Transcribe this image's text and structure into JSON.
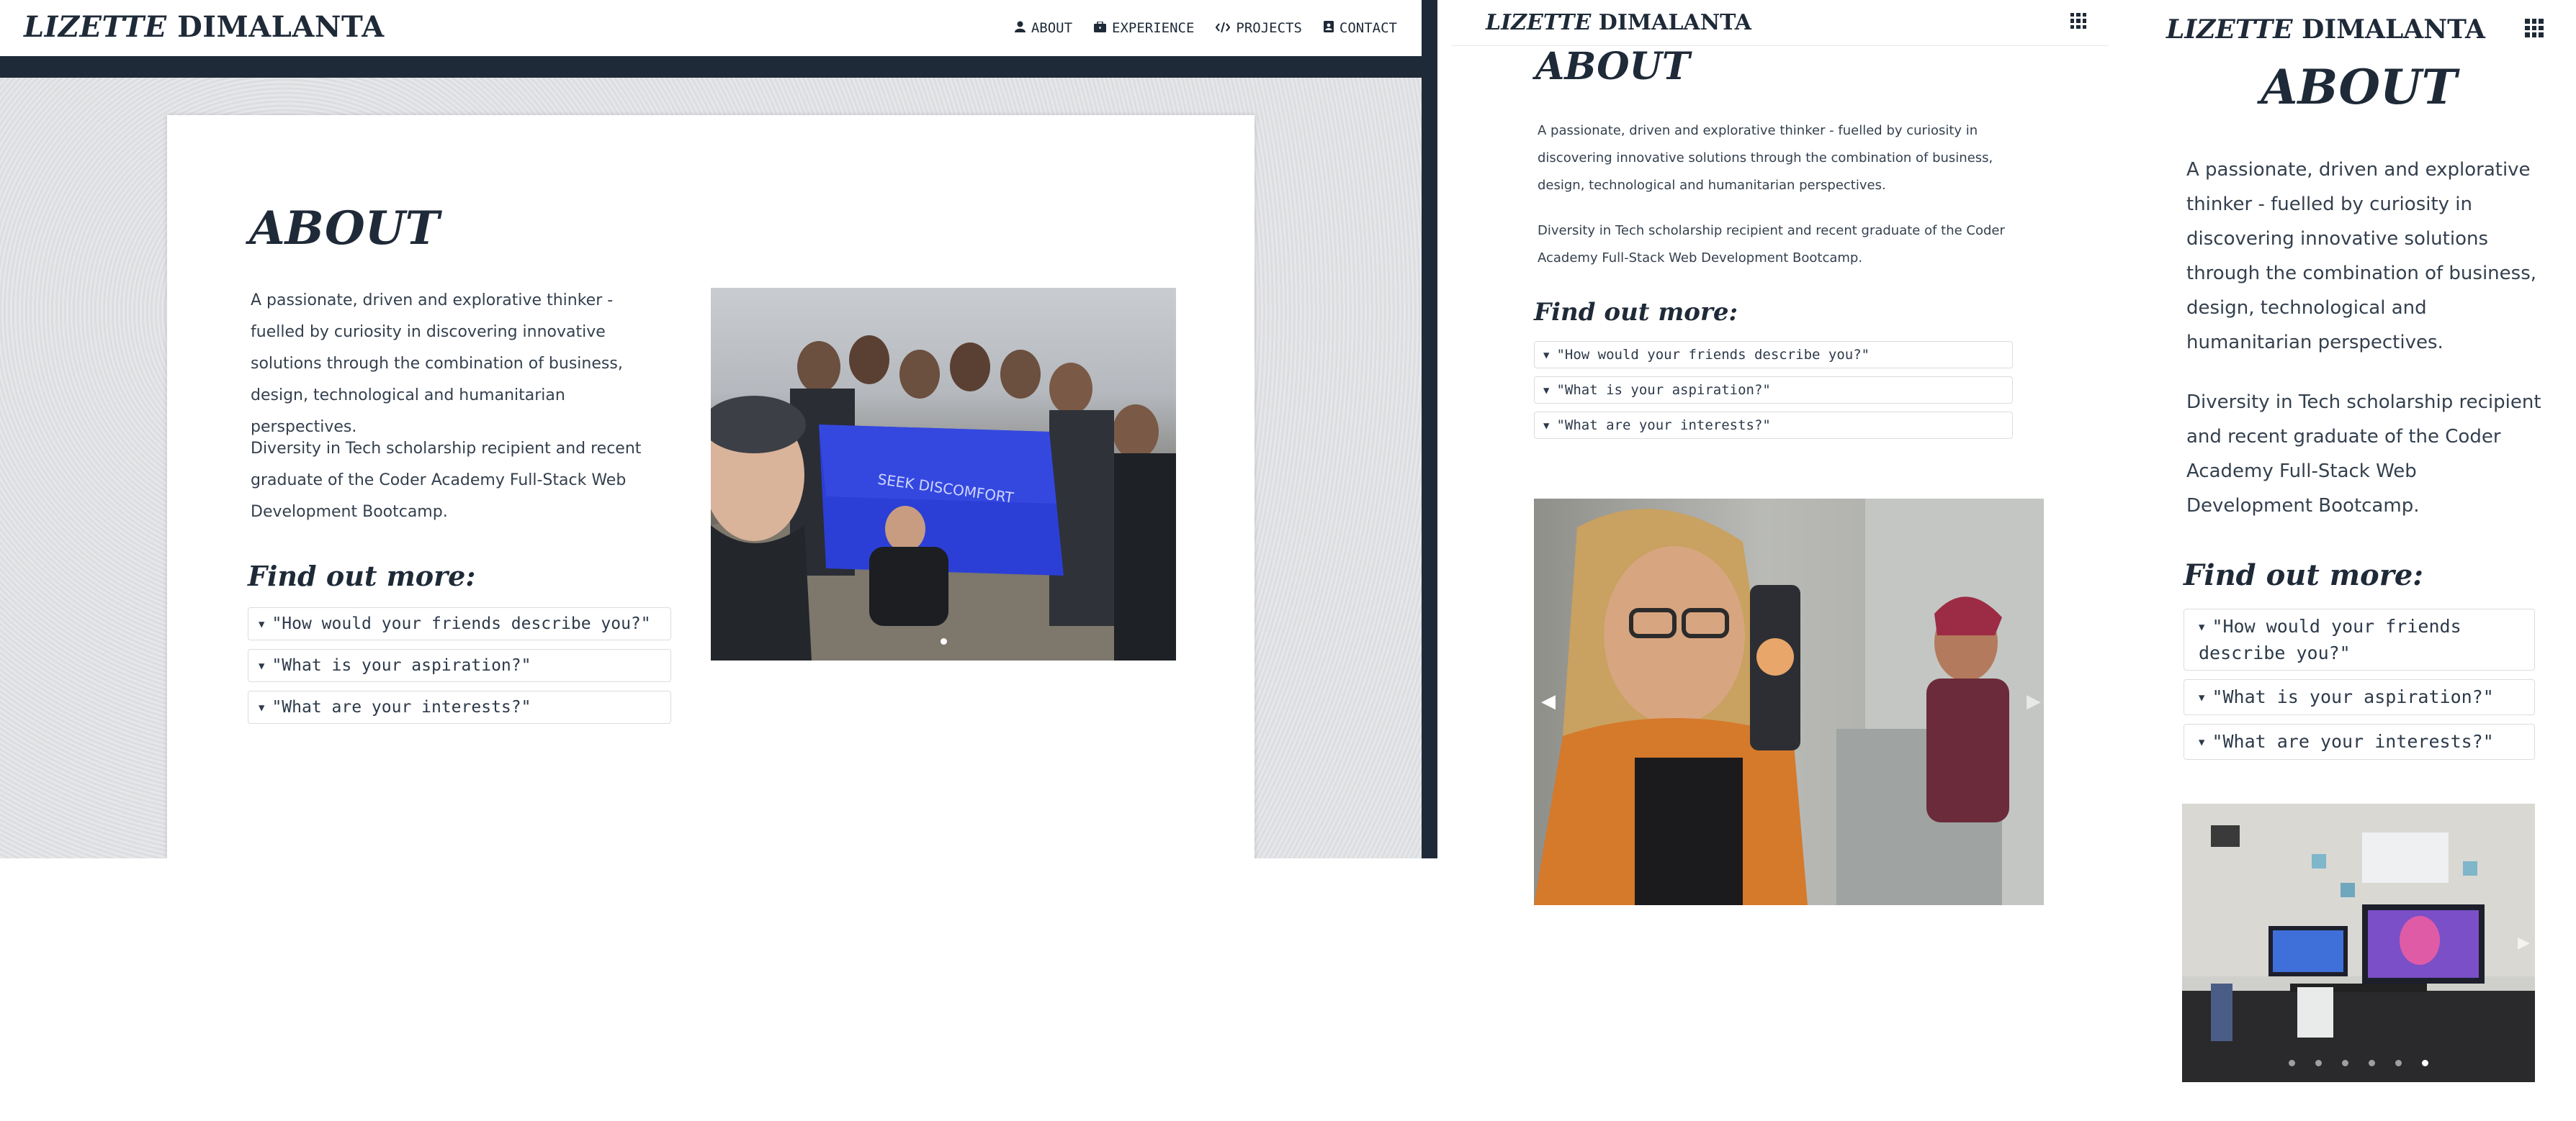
{
  "brand": {
    "first": "LIZETTE",
    "last": "DIMALANTA"
  },
  "nav": [
    {
      "label": "ABOUT",
      "icon": "user-icon"
    },
    {
      "label": "EXPERIENCE",
      "icon": "briefcase-icon"
    },
    {
      "label": "PROJECTS",
      "icon": "code-icon"
    },
    {
      "label": "CONTACT",
      "icon": "contact-card-icon"
    }
  ],
  "about": {
    "title": "ABOUT",
    "para1": "A passionate, driven and explorative thinker - fuelled by curiosity in discovering innovative solutions through the combination of business, design, technological and humanitarian perspectives.",
    "para2": "Diversity in Tech scholarship recipient and recent graduate of the Coder Academy Full-Stack Web Development Bootcamp.",
    "find_more": "Find out more:",
    "questions": [
      "\"How would your friends describe you?\"",
      "\"What is your aspiration?\"",
      "\"What are your interests?\""
    ]
  },
  "carousel": {
    "desktop_photo": "group-photo-with-blue-flag",
    "tablet_photo": "selfie-in-kitchen",
    "mobile_photo": "desk-setup-with-monitors",
    "desktop_slides": 1,
    "desktop_active": 1,
    "mobile_slides": 6,
    "mobile_active": 6
  },
  "colors": {
    "navy": "#1f2a38",
    "flag_blue": "#2b3fd6",
    "text": "#34404e"
  }
}
